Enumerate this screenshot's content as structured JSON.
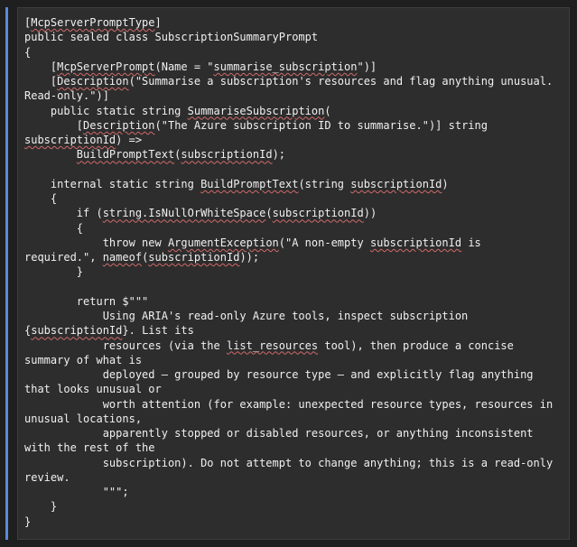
{
  "editor": {
    "lines": [
      "[McpServerPromptType]",
      "public sealed class SubscriptionSummaryPrompt",
      "{",
      "    [McpServerPrompt(Name = \"summarise_subscription\")]",
      "    [Description(\"Summarise a subscription's resources and flag anything unusual.",
      "Read-only.\")]",
      "    public static string SummariseSubscription(",
      "        [Description(\"The Azure subscription ID to summarise.\")] string",
      "subscriptionId) =>",
      "        BuildPromptText(subscriptionId);",
      "",
      "    internal static string BuildPromptText(string subscriptionId)",
      "    {",
      "        if (string.IsNullOrWhiteSpace(subscriptionId))",
      "        {",
      "            throw new ArgumentException(\"A non-empty subscriptionId is",
      "required.\", nameof(subscriptionId));",
      "        }",
      "",
      "        return $\"\"\"",
      "            Using ARIA's read-only Azure tools, inspect subscription",
      "{subscriptionId}. List its",
      "            resources (via the list_resources tool), then produce a concise",
      "summary of what is",
      "            deployed — grouped by resource type — and explicitly flag anything",
      "that looks unusual or",
      "            worth attention (for example: unexpected resource types, resources in",
      "unusual locations,",
      "            apparently stopped or disabled resources, or anything inconsistent",
      "with the rest of the",
      "            subscription). Do not attempt to change anything; this is a read-only",
      "review.",
      "            \"\"\";",
      "    }",
      "}"
    ],
    "squiggles": [
      "McpServerPromptType",
      "McpServerPrompt",
      "summarise_subscription",
      "Description",
      "SummariseSubscription",
      "subscriptionId",
      "BuildPromptText",
      "string.IsNullOrWhiteSpace",
      "ArgumentException",
      "nameof",
      "list_resources"
    ],
    "colors": {
      "text": "#f0f0f0",
      "background": "#2d2d2d",
      "squiggle": "#d16969",
      "gutter_marker": "#5a8ad6"
    }
  }
}
